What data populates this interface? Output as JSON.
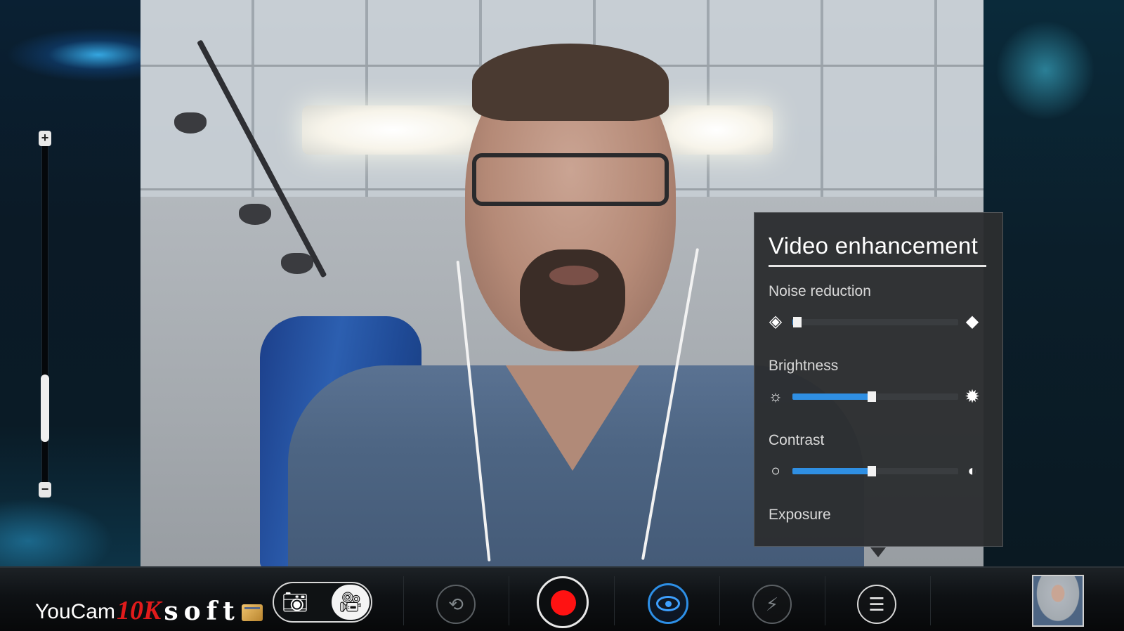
{
  "zoom": {
    "plus_label": "+",
    "minus_label": "−",
    "level": 0.15
  },
  "enhancement_panel": {
    "title": "Video enhancement",
    "settings": [
      {
        "label": "Noise reduction",
        "left_icon": "noise-low-icon",
        "right_icon": "noise-high-icon",
        "value": 0.03
      },
      {
        "label": "Brightness",
        "left_icon": "brightness-low-icon",
        "right_icon": "brightness-high-icon",
        "value": 0.48
      },
      {
        "label": "Contrast",
        "left_icon": "contrast-low-icon",
        "right_icon": "contrast-high-icon",
        "value": 0.48
      },
      {
        "label": "Exposure"
      }
    ]
  },
  "toolbar": {
    "brand_youcam": "YouCam",
    "brand_10k": "10K",
    "brand_soft": "soft",
    "photo_mode_icon": "camera-icon",
    "video_mode_icon": "video-camera-icon",
    "switch_camera_icon": "switch-camera-icon",
    "record_icon": "record-icon",
    "enhance_icon": "eye-icon",
    "flash_icon": "flash-icon",
    "settings_icon": "adjustments-icon"
  },
  "colors": {
    "accent_blue": "#2f8fe3",
    "record_red": "#ff1212",
    "panel_bg": "#2c2e30"
  }
}
